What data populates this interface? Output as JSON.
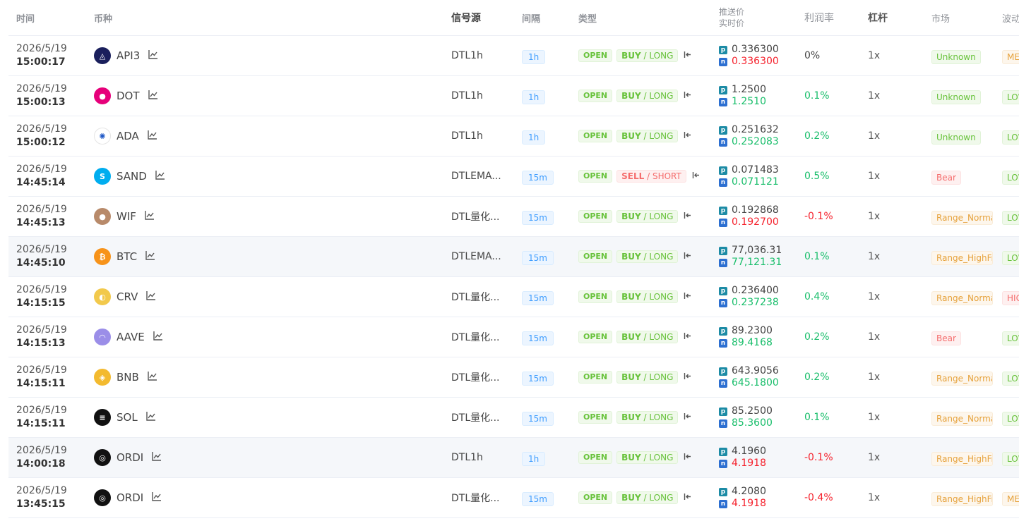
{
  "headers": {
    "time": "时间",
    "coin": "币种",
    "source": "信号源",
    "interval": "间隔",
    "type": "类型",
    "push_price": "推送价",
    "live_price": "实时价",
    "profit": "利润率",
    "leverage": "杠杆",
    "market": "市场",
    "volatility": "波动"
  },
  "colors": {
    "green": "#19be6b",
    "red": "#f5222d",
    "tag_blue": "#409eff"
  },
  "badges": {
    "push": "p",
    "live": "n"
  },
  "rows": [
    {
      "date": "2026/5/19",
      "time": "15:00:17",
      "coin": "API3",
      "icon": "api3-icon",
      "icon_color": "#1a1f5c",
      "glyph": "◬",
      "source": "DTL1h",
      "interval": "1h",
      "status": "OPEN",
      "dir_a": "BUY",
      "dir_b": "LONG",
      "push": "0.336300",
      "live": "0.336300",
      "live_color": "red",
      "profit": "0%",
      "profit_color": "dark",
      "lev": "1x",
      "market": "Unknown",
      "mkt_color": "green",
      "vol": "MEDIUM",
      "vol_color": "orange"
    },
    {
      "date": "2026/5/19",
      "time": "15:00:13",
      "coin": "DOT",
      "icon": "polkadot-icon",
      "icon_color": "#e6007a",
      "glyph": "●",
      "source": "DTL1h",
      "interval": "1h",
      "status": "OPEN",
      "dir_a": "BUY",
      "dir_b": "LONG",
      "push": "1.2500",
      "live": "1.2510",
      "live_color": "green",
      "profit": "0.1%",
      "profit_color": "green",
      "lev": "1x",
      "market": "Unknown",
      "mkt_color": "green",
      "vol": "LOW",
      "vol_color": "green"
    },
    {
      "date": "2026/5/19",
      "time": "15:00:12",
      "coin": "ADA",
      "icon": "cardano-icon",
      "icon_color": "#ffffff",
      "glyph": "✺",
      "source": "DTL1h",
      "interval": "1h",
      "status": "OPEN",
      "dir_a": "BUY",
      "dir_b": "LONG",
      "push": "0.251632",
      "live": "0.252083",
      "live_color": "green",
      "profit": "0.2%",
      "profit_color": "green",
      "lev": "1x",
      "market": "Unknown",
      "mkt_color": "green",
      "vol": "LOW",
      "vol_color": "green"
    },
    {
      "date": "2026/5/19",
      "time": "14:45:14",
      "coin": "SAND",
      "icon": "sandbox-icon",
      "icon_color": "#00adef",
      "glyph": "S",
      "source": "DTLEMA...",
      "interval": "15m",
      "status": "OPEN",
      "dir_a": "SELL",
      "dir_b": "SHORT",
      "push": "0.071483",
      "live": "0.071121",
      "live_color": "green",
      "profit": "0.5%",
      "profit_color": "green",
      "lev": "1x",
      "market": "Bear",
      "mkt_color": "red",
      "vol": "LOW",
      "vol_color": "green"
    },
    {
      "date": "2026/5/19",
      "time": "14:45:13",
      "coin": "WIF",
      "icon": "dogwifhat-icon",
      "icon_color": "#b88a6a",
      "glyph": "●",
      "source": "DTL量化...",
      "interval": "15m",
      "status": "OPEN",
      "dir_a": "BUY",
      "dir_b": "LONG",
      "push": "0.192868",
      "live": "0.192700",
      "live_color": "red",
      "profit": "-0.1%",
      "profit_color": "red",
      "lev": "1x",
      "market": "Range_Normal",
      "mkt_color": "orange",
      "vol": "LOW",
      "vol_color": "green"
    },
    {
      "date": "2026/5/19",
      "time": "14:45:10",
      "coin": "BTC",
      "icon": "bitcoin-icon",
      "icon_color": "#f7931a",
      "glyph": "₿",
      "source": "DTLEMA...",
      "interval": "15m",
      "status": "OPEN",
      "dir_a": "BUY",
      "dir_b": "LONG",
      "push": "77,036.31",
      "live": "77,121.31",
      "live_color": "green",
      "profit": "0.1%",
      "profit_color": "green",
      "lev": "1x",
      "market": "Range_HighFreq",
      "mkt_color": "orange",
      "vol": "LOW",
      "vol_color": "green"
    },
    {
      "date": "2026/5/19",
      "time": "14:15:15",
      "coin": "CRV",
      "icon": "curve-icon",
      "icon_color": "#f2c94c",
      "glyph": "◐",
      "source": "DTL量化...",
      "interval": "15m",
      "status": "OPEN",
      "dir_a": "BUY",
      "dir_b": "LONG",
      "push": "0.236400",
      "live": "0.237238",
      "live_color": "green",
      "profit": "0.4%",
      "profit_color": "green",
      "lev": "1x",
      "market": "Range_Normal",
      "mkt_color": "orange",
      "vol": "HIGH",
      "vol_color": "red"
    },
    {
      "date": "2026/5/19",
      "time": "14:15:13",
      "coin": "AAVE",
      "icon": "aave-icon",
      "icon_color": "#9b8ee8",
      "glyph": "◠",
      "source": "DTL量化...",
      "interval": "15m",
      "status": "OPEN",
      "dir_a": "BUY",
      "dir_b": "LONG",
      "push": "89.2300",
      "live": "89.4168",
      "live_color": "green",
      "profit": "0.2%",
      "profit_color": "green",
      "lev": "1x",
      "market": "Bear",
      "mkt_color": "red",
      "vol": "LOW",
      "vol_color": "green"
    },
    {
      "date": "2026/5/19",
      "time": "14:15:11",
      "coin": "BNB",
      "icon": "bnb-icon",
      "icon_color": "#f3ba2f",
      "glyph": "◈",
      "source": "DTL量化...",
      "interval": "15m",
      "status": "OPEN",
      "dir_a": "BUY",
      "dir_b": "LONG",
      "push": "643.9056",
      "live": "645.1800",
      "live_color": "green",
      "profit": "0.2%",
      "profit_color": "green",
      "lev": "1x",
      "market": "Range_Normal",
      "mkt_color": "orange",
      "vol": "LOW",
      "vol_color": "green"
    },
    {
      "date": "2026/5/19",
      "time": "14:15:11",
      "coin": "SOL",
      "icon": "solana-icon",
      "icon_color": "#111111",
      "glyph": "≡",
      "source": "DTL量化...",
      "interval": "15m",
      "status": "OPEN",
      "dir_a": "BUY",
      "dir_b": "LONG",
      "push": "85.2500",
      "live": "85.3600",
      "live_color": "green",
      "profit": "0.1%",
      "profit_color": "green",
      "lev": "1x",
      "market": "Range_Normal",
      "mkt_color": "orange",
      "vol": "LOW",
      "vol_color": "green"
    },
    {
      "date": "2026/5/19",
      "time": "14:00:18",
      "coin": "ORDI",
      "icon": "ordi-icon",
      "icon_color": "#111111",
      "glyph": "◎",
      "source": "DTL1h",
      "interval": "1h",
      "status": "OPEN",
      "dir_a": "BUY",
      "dir_b": "LONG",
      "push": "4.1960",
      "live": "4.1918",
      "live_color": "red",
      "profit": "-0.1%",
      "profit_color": "red",
      "lev": "1x",
      "market": "Range_HighFreq",
      "mkt_color": "orange",
      "vol": "LOW",
      "vol_color": "green"
    },
    {
      "date": "2026/5/19",
      "time": "13:45:15",
      "coin": "ORDI",
      "icon": "ordi-icon",
      "icon_color": "#111111",
      "glyph": "◎",
      "source": "DTL量化...",
      "interval": "15m",
      "status": "OPEN",
      "dir_a": "BUY",
      "dir_b": "LONG",
      "push": "4.2080",
      "live": "4.1918",
      "live_color": "red",
      "profit": "-0.4%",
      "profit_color": "red",
      "lev": "1x",
      "market": "Range_HighFreq",
      "mkt_color": "orange",
      "vol": "MEDIUM",
      "vol_color": "orange"
    }
  ]
}
